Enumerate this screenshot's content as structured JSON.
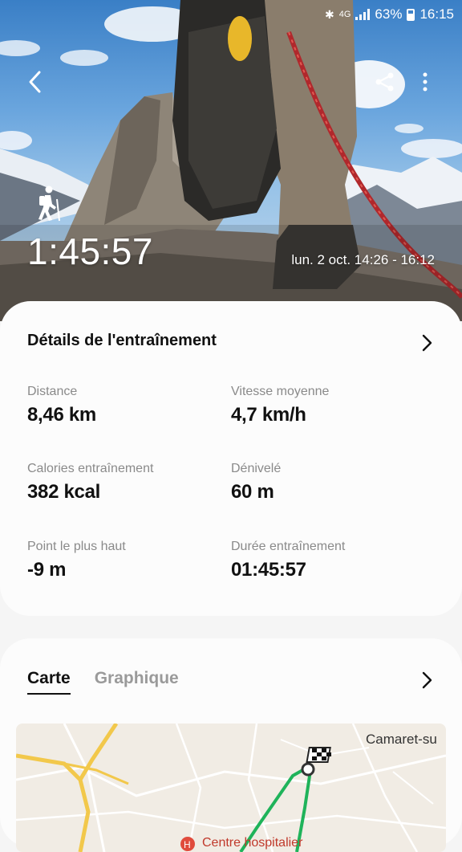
{
  "status_bar": {
    "network": "4G",
    "battery": "63%",
    "time": "16:15"
  },
  "hero": {
    "activity_icon": "hiking-icon",
    "duration": "1:45:57",
    "date_range": "lun. 2 oct. 14:26 - 16:12"
  },
  "details": {
    "title": "Détails de l'entraînement",
    "stats": [
      {
        "label": "Distance",
        "value": "8,46 km"
      },
      {
        "label": "Vitesse moyenne",
        "value": "4,7 km/h"
      },
      {
        "label": "Calories entraînement",
        "value": "382 kcal"
      },
      {
        "label": "Dénivelé",
        "value": "60 m"
      },
      {
        "label": "Point le plus haut",
        "value": "-9 m"
      },
      {
        "label": "Durée entraînement",
        "value": "01:45:57"
      }
    ]
  },
  "map_section": {
    "tabs": [
      "Carte",
      "Graphique"
    ],
    "active_tab": "Carte",
    "place_label": "Camaret-su",
    "poi_label": "Centre hospitalier",
    "colors": {
      "route": "#1fb35a",
      "road": "#f2c84b",
      "poi": "#e04b3c"
    }
  }
}
